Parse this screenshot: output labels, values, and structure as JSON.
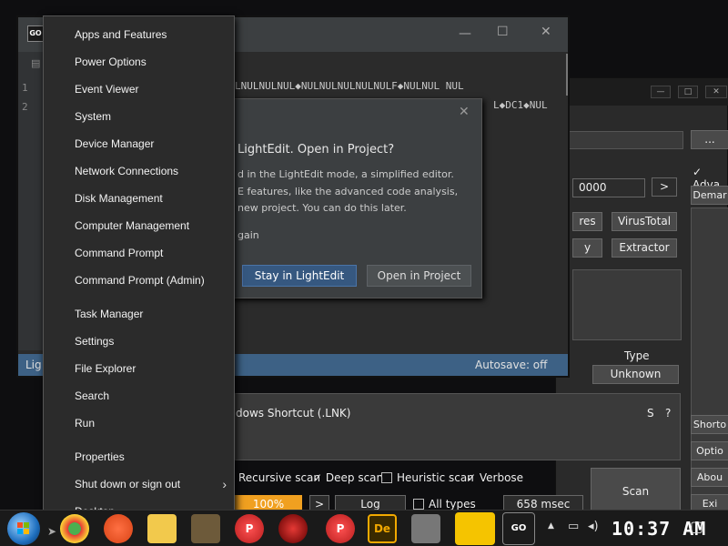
{
  "scanner": {
    "path_button": "...",
    "advanced_label": "Adva",
    "demand_label": "Demar",
    "timeout_value": "0000",
    "next_label": ">",
    "btn_features": "res",
    "btn_virustotal": "VirusTotal",
    "btn_y": "y",
    "btn_extractor": "Extractor",
    "type_header": "Type",
    "type_value": "Unknown",
    "file_type": "dows Shortcut (.LNK)",
    "s_label": "S",
    "help_label": "?",
    "options": {
      "recursive": "Recursive scan",
      "deep": "Deep scan",
      "heuristic": "Heuristic scan",
      "verbose": "Verbose"
    },
    "progress": "100%",
    "progress_fraction": 1.0,
    "expand_label": ">",
    "log_label": "Log",
    "all_types": "All types",
    "duration": "658 msec",
    "scan_label": "Scan",
    "side_buttons": [
      "Shorto",
      "Optio",
      "Abou",
      "Exi"
    ]
  },
  "ide": {
    "icon_text": "GO",
    "code_line_1": "LNULNULNUL◆NULNULNULNULNULF◆NULNUL NUL",
    "code_line_2": "L◆DC1◆NUL",
    "line_numbers": [
      "1",
      "2"
    ],
    "status_left": "Lig",
    "status_autosave": "Autosave: off"
  },
  "dialog": {
    "title": "LightEdit. Open in Project?",
    "body_1": "d in the LightEdit mode, a simplified editor.",
    "body_2": "E features, like the advanced code analysis,",
    "body_3": "new project. You can do this later.",
    "dont_ask": "gain",
    "stay_button": "Stay in LightEdit",
    "open_button": "Open in Project"
  },
  "winx_menu": {
    "items": [
      "Apps and Features",
      "Power Options",
      "Event Viewer",
      "System",
      "Device Manager",
      "Network Connections",
      "Disk Management",
      "Computer Management",
      "Command Prompt",
      "Command Prompt (Admin)",
      "Task Manager",
      "Settings",
      "File Explorer",
      "Search",
      "Run",
      "Properties",
      "Shut down or sign out",
      "Desktop"
    ]
  },
  "taskbar": {
    "clock": "10:37 AM",
    "tray_up": "▲",
    "icons": [
      "start-orb",
      "chrome",
      "firefox",
      "file-explorer",
      "app-ps",
      "app-red-ps",
      "app-radiation",
      "app-ps-2",
      "app-de",
      "app-camera",
      "app-chrome-character",
      "app-goland"
    ]
  },
  "colors": {
    "accent_blue": "#365880",
    "status_bar": "#3d6185",
    "progress_orange": "#f0a020",
    "menu_bg": "#2b2b2b"
  }
}
